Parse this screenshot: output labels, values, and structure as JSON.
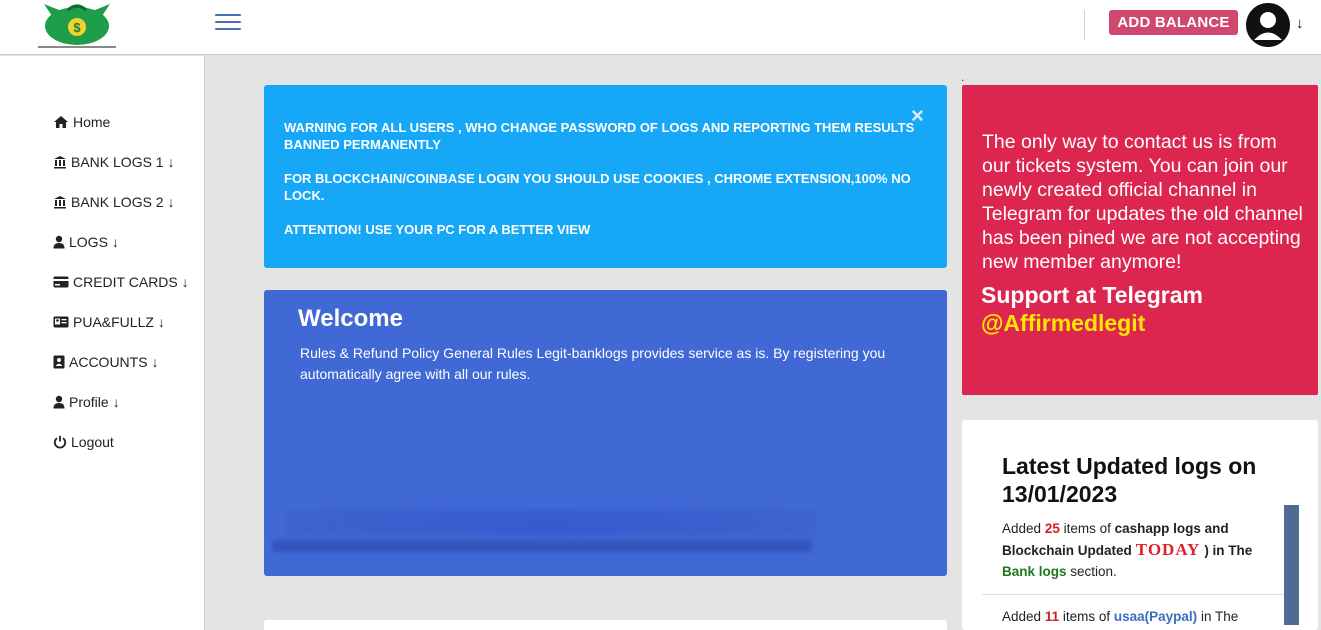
{
  "header": {
    "add_balance": "ADD BALANCE",
    "avatar_arrow": "↓"
  },
  "sidebar": {
    "items": [
      {
        "label": "Home",
        "icon": "home-icon",
        "has_arrow": false
      },
      {
        "label": "BANK LOGS 1",
        "icon": "bank-icon",
        "has_arrow": true
      },
      {
        "label": "BANK LOGS 2",
        "icon": "bank-icon",
        "has_arrow": true
      },
      {
        "label": "LOGS",
        "icon": "user-icon",
        "has_arrow": true
      },
      {
        "label": "CREDIT CARDS",
        "icon": "credit-card-icon",
        "has_arrow": true
      },
      {
        "label": "PUA&FULLZ",
        "icon": "id-card-icon",
        "has_arrow": true
      },
      {
        "label": "ACCOUNTS",
        "icon": "contact-book-icon",
        "has_arrow": true
      },
      {
        "label": "Profile",
        "icon": "user-icon",
        "has_arrow": true
      },
      {
        "label": "Logout",
        "icon": "power-icon",
        "has_arrow": false
      }
    ],
    "arrow": "↓"
  },
  "dot": ".",
  "warning": {
    "line1": "WARNING FOR ALL USERS , WHO CHANGE PASSWORD OF LOGS AND REPORTING THEM RESULTS BANNED PERMANENTLY",
    "line2": "FOR BLOCKCHAIN/COINBASE LOGIN YOU SHOULD USE COOKIES , CHROME EXTENSION,100% NO LOCK.",
    "line3": "ATTENTION! USE YOUR PC FOR A BETTER VIEW",
    "close": "×"
  },
  "welcome": {
    "title": "Welcome",
    "text": "Rules & Refund Policy General Rules Legit-banklogs provides service as is. By registering you automatically agree with all our rules."
  },
  "contact": {
    "text": "The only way to contact us is from our tickets system. You can join our newly created official channel in Telegram for updates the old channel has been pined we are not accepting new member anymore!",
    "support": "Support at Telegram",
    "handle": "@Affirmedlegit"
  },
  "latest": {
    "title": "Latest Updated logs on 13/01/2023",
    "entry1": {
      "prefix": "Added",
      "count": "25",
      "mid": "items of",
      "item": "cashapp logs and Blockchain Updated",
      "today": "TODAY",
      "suffix": ") in The",
      "section": "Bank logs",
      "end": "section."
    },
    "entry2": {
      "prefix": "Added",
      "count": "11",
      "mid": "items of",
      "item": "usaa(Paypal)",
      "suffix": "in The"
    }
  },
  "colors": {
    "warning_bg": "#16a7f7",
    "welcome_bg": "#4169d6",
    "contact_bg": "#dc264f",
    "handle": "#ffe600",
    "add_balance_bg": "#d0486e"
  }
}
